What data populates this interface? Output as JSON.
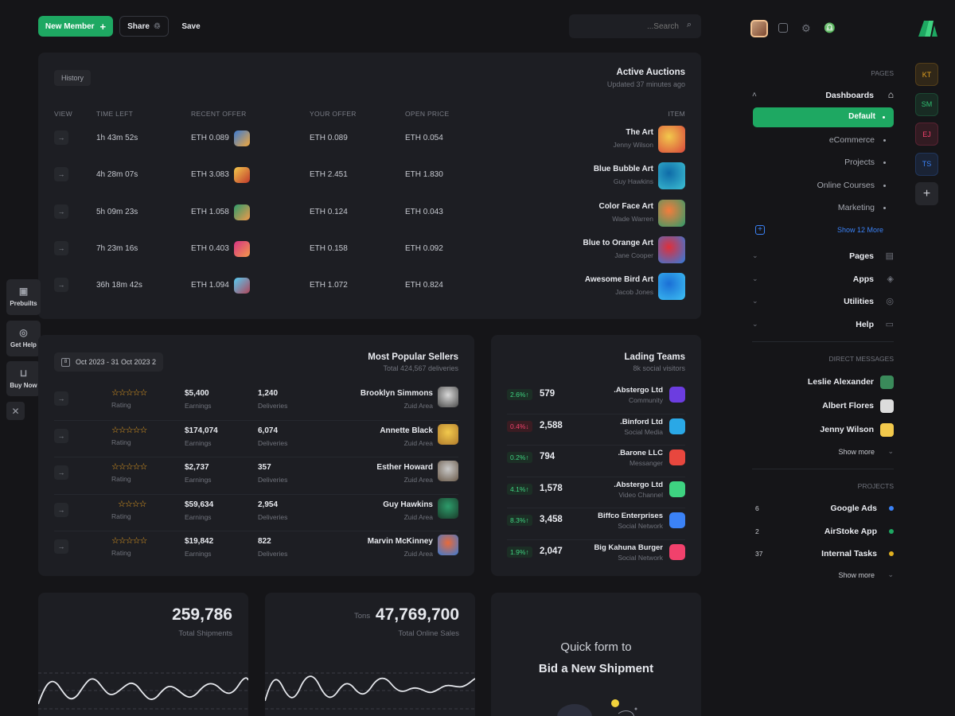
{
  "toolbar": {
    "new_member": "New Member",
    "new_member_icon": "plus-icon",
    "share": "Share",
    "save": "Save",
    "search_placeholder": "...Search"
  },
  "auctions": {
    "history_label": "History",
    "title": "Active Auctions",
    "subtitle": "Updated 37 minutes ago",
    "columns": [
      "VIEW",
      "TIME LEFT",
      "RECENT OFFER",
      "YOUR OFFER",
      "OPEN PRICE",
      "ITEM"
    ],
    "rows": [
      {
        "time_left": "1h 43m 52s",
        "recent_offer": "ETH 0.089",
        "your_offer": "ETH 0.089",
        "open_price": "ETH 0.054",
        "item": "The Art",
        "artist": "Jenny Wilson"
      },
      {
        "time_left": "4h 28m 07s",
        "recent_offer": "ETH 3.083",
        "your_offer": "ETH 2.451",
        "open_price": "ETH 1.830",
        "item": "Blue Bubble Art",
        "artist": "Guy Hawkins"
      },
      {
        "time_left": "5h 09m 23s",
        "recent_offer": "ETH 1.058",
        "your_offer": "ETH 0.124",
        "open_price": "ETH 0.043",
        "item": "Color Face Art",
        "artist": "Wade Warren"
      },
      {
        "time_left": "7h 23m 16s",
        "recent_offer": "ETH 0.403",
        "your_offer": "ETH 0.158",
        "open_price": "ETH 0.092",
        "item": "Blue to Orange Art",
        "artist": "Jane Cooper"
      },
      {
        "time_left": "36h 18m 42s",
        "recent_offer": "ETH 1.094",
        "your_offer": "ETH 1.072",
        "open_price": "ETH 0.824",
        "item": "Awesome Bird Art",
        "artist": "Jacob Jones"
      }
    ]
  },
  "sellers": {
    "date_range": "Oct 2023 - 31 Oct 2023 2",
    "title": "Most Popular Sellers",
    "subtitle": "Total 424,567 deliveries",
    "rating_label": "Rating",
    "earnings_label": "Earnings",
    "deliveries_label": "Deliveries",
    "rows": [
      {
        "stars": "☆☆☆☆☆",
        "earnings": "$5,400",
        "deliveries": "1,240",
        "name": "Brooklyn Simmons",
        "area": "Zuid Area"
      },
      {
        "stars": "☆☆☆☆☆",
        "earnings": "$174,074",
        "deliveries": "6,074",
        "name": "Annette Black",
        "area": "Zuid Area"
      },
      {
        "stars": "☆☆☆☆☆",
        "earnings": "$2,737",
        "deliveries": "357",
        "name": "Esther Howard",
        "area": "Zuid Area"
      },
      {
        "stars": "☆☆☆☆",
        "earnings": "$59,634",
        "deliveries": "2,954",
        "name": "Guy Hawkins",
        "area": "Zuid Area"
      },
      {
        "stars": "☆☆☆☆☆",
        "earnings": "$19,842",
        "deliveries": "822",
        "name": "Marvin McKinney",
        "area": "Zuid Area"
      }
    ]
  },
  "teams": {
    "title": "Lading Teams",
    "subtitle": "8k social visitors",
    "rows": [
      {
        "badge": "2.6%↑",
        "trend": "up",
        "value": "579",
        "name": ".Abstergo Ltd",
        "category": "Community",
        "logo_color": "#6c3de0"
      },
      {
        "badge": "0.4%↓",
        "trend": "down",
        "value": "2,588",
        "name": ".Binford Ltd",
        "category": "Social Media",
        "logo_color": "#2aa8e6"
      },
      {
        "badge": "0.2%↑",
        "trend": "up",
        "value": "794",
        "name": ".Barone LLC",
        "category": "Messanger",
        "logo_color": "#e8473e"
      },
      {
        "badge": "4.1%↑",
        "trend": "up",
        "value": "1,578",
        "name": ".Abstergo Ltd",
        "category": "Video Channel",
        "logo_color": "#3ed381"
      },
      {
        "badge": "8.3%↑",
        "trend": "up",
        "value": "3,458",
        "name": "Biffco Enterprises",
        "category": "Social Network",
        "logo_color": "#3b82f6"
      },
      {
        "badge": "1.9%↑",
        "trend": "up",
        "value": "2,047",
        "name": "Big Kahuna Burger",
        "category": "Social Network",
        "logo_color": "#f1416c"
      }
    ]
  },
  "stats": [
    {
      "prefix": "",
      "value": "259,786",
      "label": "Total Shipments"
    },
    {
      "prefix": "Tons",
      "value": "47,769,700",
      "label": "Total Online Sales"
    }
  ],
  "quickform": {
    "line1": "Quick form to",
    "line2": "Bid a New Shipment"
  },
  "sidetabs": [
    {
      "label": "Prebuilts",
      "icon": "layout-icon"
    },
    {
      "label": "Get Help",
      "icon": "lifebuoy-icon"
    },
    {
      "label": "Buy Now",
      "icon": "basket-icon"
    }
  ],
  "sidebar": {
    "pages_header": "PAGES",
    "dashboards": "Dashboards",
    "dashboard_items": [
      "Default",
      "eCommerce",
      "Projects",
      "Online Courses",
      "Marketing"
    ],
    "show_more_link": "Show 12 More",
    "menu": [
      "Pages",
      "Apps",
      "Utilities",
      "Help"
    ],
    "dm_header": "DIRECT MESSAGES",
    "dms": [
      "Leslie Alexander",
      "Albert Flores",
      "Jenny Wilson"
    ],
    "show_more": "Show more",
    "projects_header": "PROJECTS",
    "projects": [
      {
        "count": "6",
        "name": "Google Ads",
        "color": "#3b82f6"
      },
      {
        "count": "2",
        "name": "AirStoke App",
        "color": "#1ea862"
      },
      {
        "count": "37",
        "name": "Internal Tasks",
        "color": "#e0b020"
      }
    ],
    "show_more_2": "Show more"
  },
  "rail": {
    "initials": [
      "KT",
      "SM",
      "EJ",
      "TS"
    ],
    "initial_colors": [
      "#e0a020",
      "#2fbf71",
      "#f1416c",
      "#3b82f6"
    ],
    "add": "+"
  }
}
